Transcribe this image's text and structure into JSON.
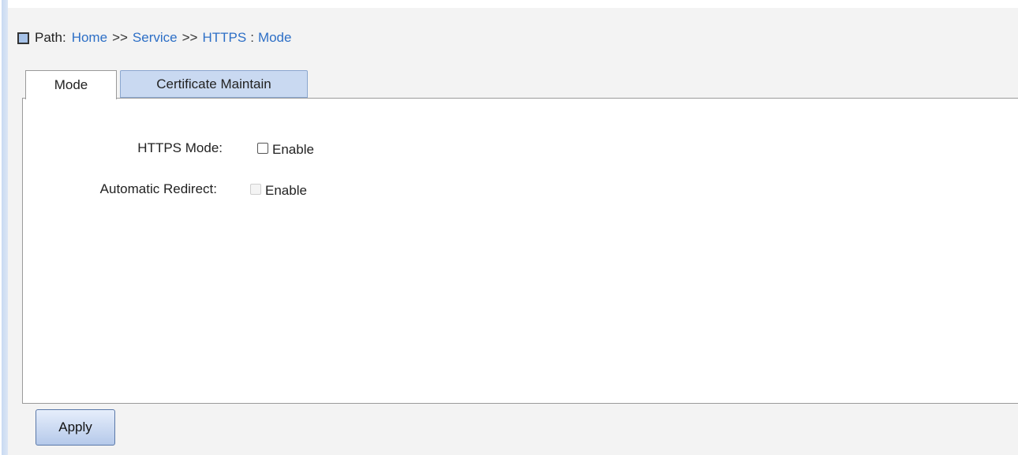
{
  "breadcrumb": {
    "label": "Path:",
    "items": [
      "Home",
      "Service",
      "HTTPS",
      "Mode"
    ],
    "separator": ">>",
    "last_separator": ":"
  },
  "tabs": [
    {
      "label": "Mode",
      "active": true
    },
    {
      "label": "Certificate Maintain",
      "active": false
    }
  ],
  "form": {
    "https_mode": {
      "label": "HTTPS Mode:",
      "option": "Enable",
      "checked": false,
      "disabled": false
    },
    "automatic_redirect": {
      "label": "Automatic Redirect:",
      "option": "Enable",
      "checked": false,
      "disabled": true
    }
  },
  "actions": {
    "apply_label": "Apply"
  },
  "colors": {
    "link": "#2d6fc6",
    "tab_inactive_bg": "#c9d9f1",
    "button_bg": "#b5c9ea"
  }
}
